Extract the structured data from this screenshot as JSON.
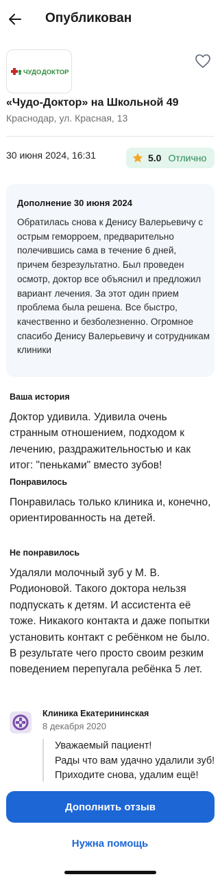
{
  "header": {
    "title": "Опубликован",
    "back_icon": "arrow-left-icon"
  },
  "clinic": {
    "logo_text": "ЧУДО ДОКТОР",
    "name": "«Чудо-Доктор» на Школьной 49",
    "address": "Краснодар, ул. Красная, 13",
    "favorite_icon": "heart-outline-icon"
  },
  "review": {
    "date": "30 июня 2024, 16:31",
    "rating_value": "5.0",
    "rating_text": "Отлично",
    "rating_icon": "star-icon"
  },
  "addendum": {
    "title": "Дополнение 30 июня 2024",
    "text": "Обратилась снова к Денису Валерьевичу с острым геморроем, предварительно полечившись сама в течение 6 дней, причем безрезультатно. Был проведен осмотр, доктор все объяснил и предложил вариант лечения. За этот один прием проблема была решена. Все быстро, качественно и безболезненно. Огромное спасибо Денису Валерьевичу и сотрудникам клиники"
  },
  "sections": {
    "story_label": "Ваша история",
    "story_text": "Доктор удивила. Удивила очень странным отношением, подходом к лечению, раздражительностью и как итог: \"пеньками\" вместо зубов!",
    "liked_label": "Понравилось",
    "liked_text": "Понравилась только клиника и, конечно, ориентированность на детей.",
    "disliked_label": "Не понравилось",
    "disliked_text": "Удаляли молочный зуб у М. В. Родионовой. Такого доктора нельзя подпускать к детям. И ассистента её тоже. Никакого контакта и даже попытки установить контакт с ребёнком не было. В результате чего просто своим резким поведением перепугала ребёнка 5 лет."
  },
  "reply": {
    "author": "Клиника Екатерининская",
    "date": "8 декабря 2020",
    "text": "Уважаемый пациент!\nРады что вам удачно удалили зуб! Приходите снова, удалим ещё!",
    "avatar_icon": "clinic-logo-icon"
  },
  "actions": {
    "primary_label": "Дополнить отзыв",
    "help_label": "Нужна помощь"
  },
  "colors": {
    "accent": "#1d66d6",
    "rating_bg": "#e3f5ec",
    "rating_text": "#2b8a57",
    "star": "#f5a623",
    "logo_green": "#2e8b3a",
    "logo_red": "#c62828"
  }
}
